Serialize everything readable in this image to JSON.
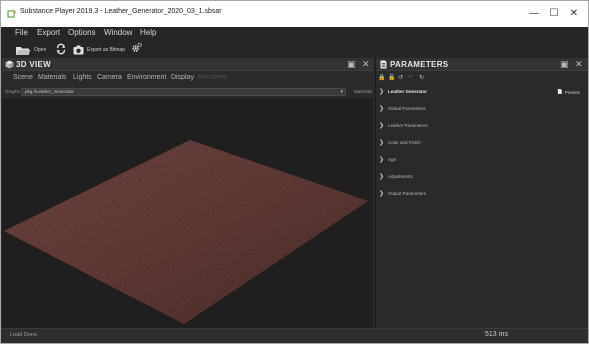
{
  "window": {
    "title": "Substance Player 2019.3 - Leather_Generator_2020_03_1.sbsar",
    "minimize": "—",
    "maximize": "☐",
    "close": "✕"
  },
  "menu": [
    "File",
    "Export",
    "Options",
    "Window",
    "Help"
  ],
  "toolbar": {
    "open_label": "Open",
    "export_bitmap_label": "Export as Bitmap"
  },
  "view3d": {
    "title": "3D VIEW",
    "tabs": [
      "Scene",
      "Materials",
      "Lights",
      "Camera",
      "Environment",
      "Display",
      "Renderer"
    ],
    "graphs_label": "Graphs",
    "graph_value": "pkg://Leather_Generator",
    "materials_label": "Materials"
  },
  "parameters": {
    "title": "PARAMETERS",
    "presets_label": "Presets",
    "items": [
      {
        "label": "Leather Generator",
        "bold": true
      },
      {
        "label": "Global Parameters",
        "bold": false
      },
      {
        "label": "Leather Parameters",
        "bold": false
      },
      {
        "label": "Color and Finish",
        "bold": false
      },
      {
        "label": "Age",
        "bold": false
      },
      {
        "label": "Adjustments",
        "bold": false
      },
      {
        "label": "Output Parameters",
        "bold": false
      }
    ]
  },
  "status": {
    "message": "Load Done.",
    "render_time": "513 ms"
  },
  "colors": {
    "leather": "#7a4a43",
    "background": "#1f1f1f",
    "panel": "#2a2a2a"
  }
}
